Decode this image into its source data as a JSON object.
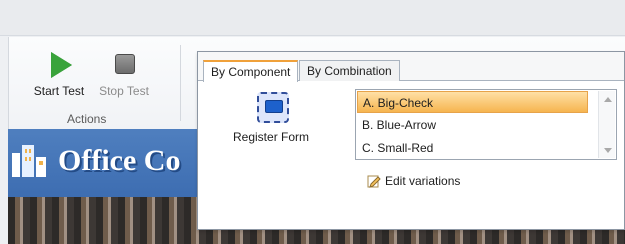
{
  "ribbon": {
    "actions_group": {
      "label": "Actions",
      "buttons": [
        {
          "label": "Start Test",
          "icon": "play-icon",
          "enabled": true,
          "color": "#39a33b"
        },
        {
          "label": "Stop Test",
          "icon": "stop-icon",
          "enabled": false,
          "color": "#6c6c6c"
        }
      ]
    }
  },
  "banner": {
    "title": "Office Co",
    "icon": "building-logo-icon",
    "color": "#4f7fbf"
  },
  "panel": {
    "tabs": [
      {
        "label": "By Component",
        "selected": true
      },
      {
        "label": "By Combination",
        "selected": false
      }
    ],
    "component": {
      "label": "Register Form",
      "icon": "form-component-icon"
    },
    "list": {
      "items": [
        "A. Big-Check",
        "B. Blue-Arrow",
        "C. Small-Red"
      ],
      "selected_index": 0
    },
    "edit_link": {
      "label": "Edit variations",
      "icon": "pencil-icon"
    },
    "accent": "#f0a13a"
  }
}
